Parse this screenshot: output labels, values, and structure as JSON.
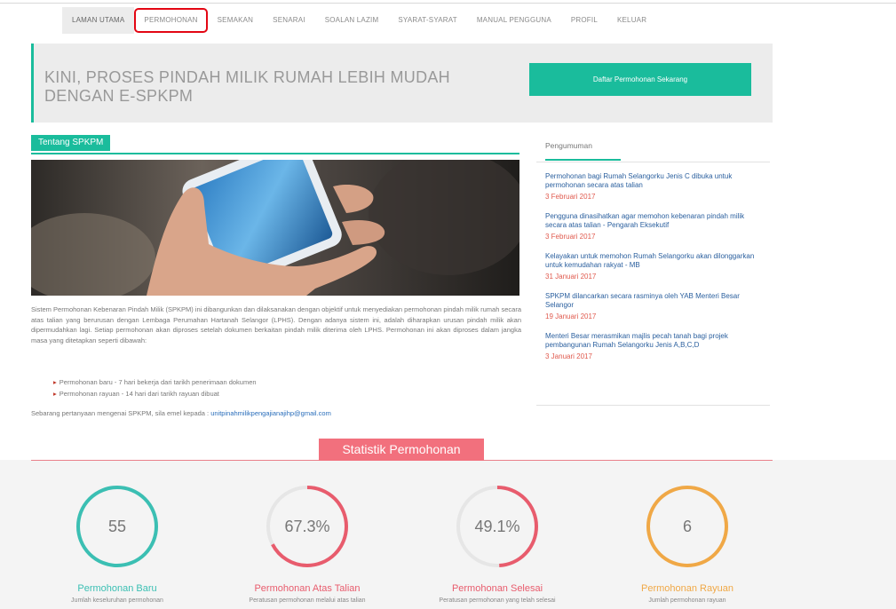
{
  "nav": {
    "items": [
      {
        "label": "LAMAN UTAMA"
      },
      {
        "label": "PERMOHONAN"
      },
      {
        "label": "SEMAKAN"
      },
      {
        "label": "SENARAI"
      },
      {
        "label": "SOALAN LAZIM"
      },
      {
        "label": "SYARAT-SYARAT"
      },
      {
        "label": "MANUAL PENGGUNA"
      },
      {
        "label": "PROFIL"
      },
      {
        "label": "KELUAR"
      }
    ]
  },
  "hero": {
    "title": "KINI, PROSES PINDAH MILIK RUMAH LEBIH MUDAH DENGAN E-SPKPM",
    "button": "Daftar Permohonan Sekarang"
  },
  "about": {
    "tab": "Tentang SPKPM",
    "paragraph": "Sistem Permohonan Kebenaran Pindah Milik (SPKPM) ini dibangunkan dan dilaksanakan dengan objektif untuk menyediakan permohonan pindah milik rumah secara atas talian yang berurusan dengan Lembaga Perumahan Hartanah Selangor (LPHS). Dengan adanya sistem ini, adalah diharapkan urusan pindah milik akan dipermudahkan lagi. Setiap permohonan akan diproses setelah dokumen berkaitan pindah milik diterima oleh LPHS. Permohonan ini akan diproses dalam jangka masa yang ditetapkan seperti dibawah:",
    "bullets": [
      "Permohonan baru - 7 hari bekerja dari tarikh penerimaan dokumen",
      "Permohonan rayuan - 14 hari dari tarikh rayuan dibuat"
    ],
    "contact_prefix": "Sebarang pertanyaan mengenai SPKPM, sila emel kepada : ",
    "contact_email": "unitpinahmilikpengajianajihp@gmail.com"
  },
  "announcements": {
    "tab": "Pengumuman",
    "items": [
      {
        "title": "Permohonan bagi Rumah Selangorku Jenis C dibuka untuk permohonan secara atas talian",
        "date": "3 Februari 2017"
      },
      {
        "title": "Pengguna dinasihatkan agar memohon kebenaran pindah milik secara atas talian - Pengarah Eksekutif",
        "date": "3 Februari 2017"
      },
      {
        "title": "Kelayakan untuk memohon Rumah Selangorku akan dilonggarkan untuk kemudahan rakyat - MB",
        "date": "31 Januari 2017"
      },
      {
        "title": "SPKPM dilancarkan secara rasminya oleh YAB Menteri Besar Selangor",
        "date": "19 Januari 2017"
      },
      {
        "title": "Menteri Besar merasmikan majlis pecah tanah bagi projek pembangunan Rumah Selangorku Jenis A,B,C,D",
        "date": "3 Januari 2017"
      }
    ]
  },
  "stats": {
    "title": "Statistik Permohonan",
    "items": [
      {
        "value": "55",
        "fraction": 1.0,
        "color": "#3bbfb3",
        "label": "Permohonan Baru",
        "sub": "Jumlah keseluruhan permohonan"
      },
      {
        "value": "67.3%",
        "fraction": 0.673,
        "color": "#e85c6d",
        "label": "Permohonan Atas Talian",
        "sub": "Peratusan permohonan melalui atas talian"
      },
      {
        "value": "49.1%",
        "fraction": 0.491,
        "color": "#e85c6d",
        "label": "Permohonan Selesai",
        "sub": "Peratusan permohonan yang telah selesai"
      },
      {
        "value": "6",
        "fraction": 1.0,
        "color": "#f0a846",
        "label": "Permohonan Rayuan",
        "sub": "Jumlah permohonan rayuan"
      }
    ]
  }
}
